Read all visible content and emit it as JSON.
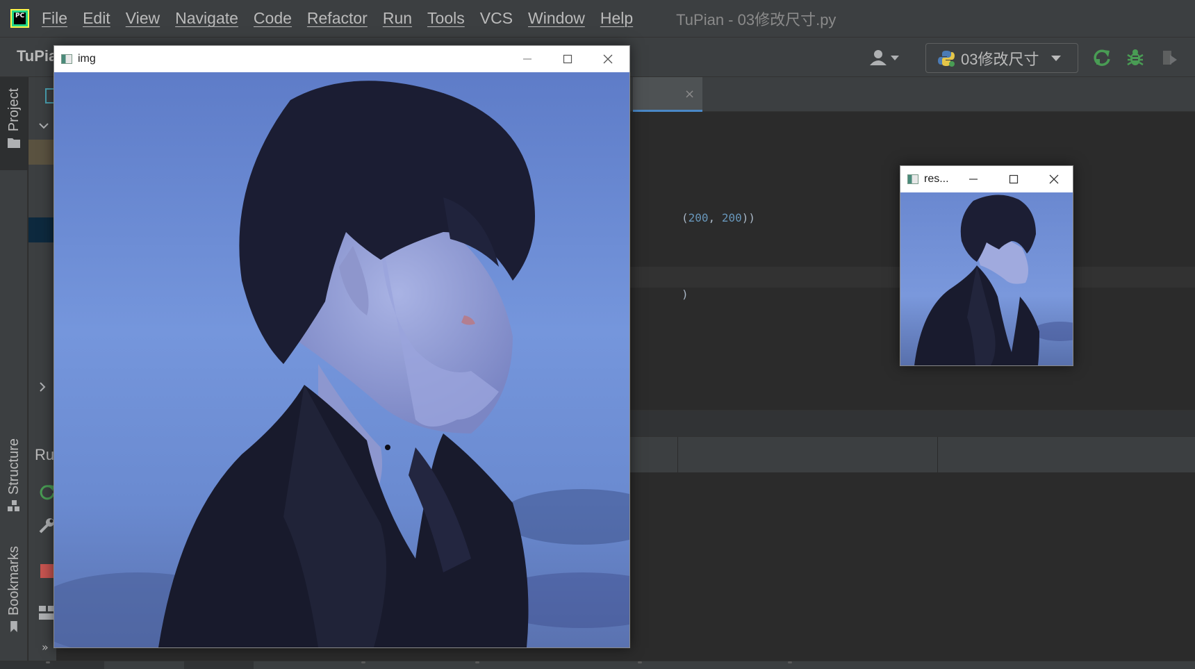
{
  "app": {
    "logo_text": "PC",
    "window_title": "TuPian - 03修改尺寸.py"
  },
  "menu": {
    "items": [
      "File",
      "Edit",
      "View",
      "Navigate",
      "Code",
      "Refactor",
      "Run",
      "Tools",
      "VCS",
      "Window",
      "Help"
    ]
  },
  "navbar": {
    "project_name": "TuPian",
    "run_config": "03修改尺寸",
    "icons": [
      "user-icon",
      "python-icon",
      "rerun-icon",
      "debug-icon",
      "stop-icon"
    ]
  },
  "left_strip": {
    "tabs": [
      "Project",
      "Structure",
      "Bookmarks"
    ]
  },
  "editor": {
    "code_fragment_1_open": "(",
    "code_fragment_1_num_a": "200",
    "code_fragment_1_sep": ", ",
    "code_fragment_1_num_b": "200",
    "code_fragment_1_close": "))",
    "code_fragment_2": ")",
    "tab_close": "×"
  },
  "run_panel": {
    "label": "Ru",
    "more": "»",
    "more2": "»"
  },
  "windows": {
    "img": {
      "title": "img"
    },
    "res": {
      "title": "res..."
    }
  },
  "colors": {
    "ide_bg": "#2b2b2b",
    "ide_panel": "#3c3f41",
    "run_green": "#499c54",
    "stop_red": "#c75450",
    "number_blue": "#6897bb",
    "photo_sky": "#6f8fd4",
    "photo_coat": "#16182a"
  }
}
